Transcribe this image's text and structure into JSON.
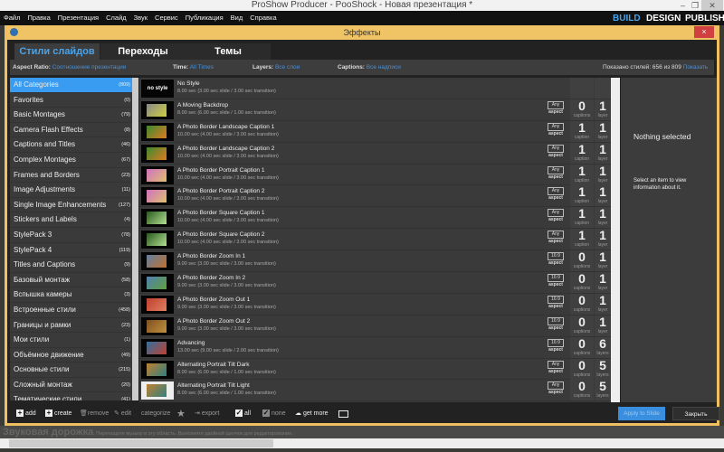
{
  "window": {
    "title": "ProShow Producer - PooShock - Новая презентация *",
    "minimize": "–",
    "maximize": "❐",
    "close": "✕"
  },
  "menu": [
    "Файл",
    "Правка",
    "Презентация",
    "Слайд",
    "Звук",
    "Сервис",
    "Публикация",
    "Вид",
    "Справка"
  ],
  "modes": {
    "build": "BUILD",
    "design": "DESIGN",
    "publish": "PUBLISH",
    "active": "BUILD"
  },
  "dialog": {
    "title": "Эффекты",
    "close": "×"
  },
  "tabs": [
    {
      "label": "Стили слайдов",
      "active": true
    },
    {
      "label": "Переходы"
    },
    {
      "label": "Темы"
    }
  ],
  "filters": {
    "aspect_label": "Aspect Ratio:",
    "aspect_value": "Соотношение презентации",
    "time_label": "Time:",
    "time_value": "All Times",
    "layers_label": "Layers:",
    "layers_value": "Все слои",
    "captions_label": "Captions:",
    "captions_value": "Все надписи",
    "shown": "Показано стилей: 656 из 809",
    "show_all": "Показать все"
  },
  "categories": [
    {
      "label": "All Categories",
      "count": "(809)",
      "selected": true
    },
    {
      "label": "Favorites",
      "count": "(0)"
    },
    {
      "label": "Basic Montages",
      "count": "(79)"
    },
    {
      "label": "Camera Flash Effects",
      "count": "(8)"
    },
    {
      "label": "Captions and Titles",
      "count": "(46)"
    },
    {
      "label": "Complex Montages",
      "count": "(67)"
    },
    {
      "label": "Frames and Borders",
      "count": "(23)"
    },
    {
      "label": "Image Adjustments",
      "count": "(11)"
    },
    {
      "label": "Single Image Enhancements",
      "count": "(127)"
    },
    {
      "label": "Stickers and Labels",
      "count": "(4)"
    },
    {
      "label": "StylePack 3",
      "count": "(78)"
    },
    {
      "label": "StylePack 4",
      "count": "(119)"
    },
    {
      "label": "Titles and Captions",
      "count": "(9)"
    },
    {
      "label": "Базовый монтаж",
      "count": "(58)"
    },
    {
      "label": "Вспышка камеры",
      "count": "(3)"
    },
    {
      "label": "Встроенные стили",
      "count": "(458)"
    },
    {
      "label": "Границы и рамки",
      "count": "(23)"
    },
    {
      "label": "Мои стили",
      "count": "(1)"
    },
    {
      "label": "Объёмное движение",
      "count": "(49)"
    },
    {
      "label": "Основные стили",
      "count": "(215)"
    },
    {
      "label": "Сложный монтаж",
      "count": "(20)"
    },
    {
      "label": "Тематические стили",
      "count": "(41)"
    }
  ],
  "styles": [
    {
      "name": "No Style",
      "desc": "8.00 sec (3.00 sec slide / 3.00 sec transition)",
      "thumb_text": "no style"
    },
    {
      "name": "A Moving Backdrop",
      "desc": "8.00 sec (6.00 sec slide / 1.00 sec transition)",
      "aspect": "Any",
      "captions": "0",
      "captions_label": "captions",
      "layers": "1",
      "layers_label": "layer",
      "thumb": [
        "#888",
        "#cfcf40"
      ]
    },
    {
      "name": "A Photo Border Landscape Caption 1",
      "desc": "10.00 sec (4.00 sec slide / 3.00 sec transition)",
      "aspect": "Any",
      "captions": "1",
      "captions_label": "caption",
      "layers": "1",
      "layers_label": "layer",
      "thumb": [
        "#3a8a30",
        "#e07a20"
      ]
    },
    {
      "name": "A Photo Border Landscape Caption 2",
      "desc": "10.00 sec (4.00 sec slide / 3.00 sec transition)",
      "aspect": "Any",
      "captions": "1",
      "captions_label": "caption",
      "layers": "1",
      "layers_label": "layer",
      "thumb": [
        "#3a8a30",
        "#e07a20"
      ]
    },
    {
      "name": "A Photo Border Portrait Caption 1",
      "desc": "10.00 sec (4.00 sec slide / 3.00 sec transition)",
      "aspect": "Any",
      "captions": "1",
      "captions_label": "caption",
      "layers": "1",
      "layers_label": "layer",
      "thumb": [
        "#d070c0",
        "#e0c070"
      ]
    },
    {
      "name": "A Photo Border Portrait Caption 2",
      "desc": "10.00 sec (4.00 sec slide / 3.00 sec transition)",
      "aspect": "Any",
      "captions": "1",
      "captions_label": "caption",
      "layers": "1",
      "layers_label": "layer",
      "thumb": [
        "#d070c0",
        "#e0c070"
      ]
    },
    {
      "name": "A Photo Border Square Caption 1",
      "desc": "10.00 sec (4.00 sec slide / 3.00 sec transition)",
      "aspect": "Any",
      "captions": "1",
      "captions_label": "caption",
      "layers": "1",
      "layers_label": "layer",
      "thumb": [
        "#2a5a20",
        "#b0e090"
      ]
    },
    {
      "name": "A Photo Border Square Caption 2",
      "desc": "10.00 sec (4.00 sec slide / 3.00 sec transition)",
      "aspect": "Any",
      "captions": "1",
      "captions_label": "caption",
      "layers": "1",
      "layers_label": "layer",
      "thumb": [
        "#2a5a20",
        "#b0e090"
      ]
    },
    {
      "name": "A Photo Border Zoom In 1",
      "desc": "9.00 sec (3.00 sec slide / 3.00 sec transition)",
      "aspect": "16:9",
      "captions": "0",
      "captions_label": "captions",
      "layers": "1",
      "layers_label": "layer",
      "thumb": [
        "#6080a0",
        "#c07030"
      ]
    },
    {
      "name": "A Photo Border Zoom In 2",
      "desc": "9.00 sec (3.00 sec slide / 3.00 sec transition)",
      "aspect": "16:9",
      "captions": "0",
      "captions_label": "captions",
      "layers": "1",
      "layers_label": "layer",
      "thumb": [
        "#5080b0",
        "#60a040"
      ]
    },
    {
      "name": "A Photo Border Zoom Out 1",
      "desc": "9.00 sec (3.00 sec slide / 3.00 sec transition)",
      "aspect": "16:9",
      "captions": "0",
      "captions_label": "captions",
      "layers": "1",
      "layers_label": "layer",
      "thumb": [
        "#c04030",
        "#e08060"
      ]
    },
    {
      "name": "A Photo Border Zoom Out 2",
      "desc": "9.00 sec (3.00 sec slide / 3.00 sec transition)",
      "aspect": "16:9",
      "captions": "0",
      "captions_label": "captions",
      "layers": "1",
      "layers_label": "layer",
      "thumb": [
        "#805020",
        "#c09040"
      ]
    },
    {
      "name": "Advancing",
      "desc": "13.00 sec (9.00 sec slide / 2.00 sec transition)",
      "aspect": "16:9",
      "captions": "0",
      "captions_label": "captions",
      "layers": "6",
      "layers_label": "layers",
      "thumb": [
        "#3070a0",
        "#c04030"
      ]
    },
    {
      "name": "Alternating Portrait Tilt Dark",
      "desc": "8.00 sec (6.00 sec slide / 1.00 sec transition)",
      "aspect": "Any",
      "captions": "0",
      "captions_label": "captions",
      "layers": "5",
      "layers_label": "layers",
      "thumb": [
        "#c08030",
        "#308080"
      ]
    },
    {
      "name": "Alternating Portrait Tilt Light",
      "desc": "8.00 sec (6.00 sec slide / 1.00 sec transition)",
      "aspect": "Any",
      "captions": "0",
      "captions_label": "captions",
      "layers": "5",
      "layers_label": "layers",
      "thumb": [
        "#c08030",
        "#308080"
      ],
      "light": true
    }
  ],
  "info": {
    "title": "Nothing selected",
    "hint": "Select an item to view information about it."
  },
  "toolbar": {
    "add": "add",
    "create": "create",
    "remove": "remove",
    "edit": "edit",
    "categorize": "categorize",
    "export": "export",
    "all": "all",
    "none": "none",
    "get_more": "get more",
    "apply": "Apply to Slide",
    "close": "Закрыть"
  },
  "audio": {
    "title": "Звуковая дорожка",
    "hint": "Перетащите музыку в эту область. Выполните двойной щелчок для редактирования."
  },
  "colors": {
    "accent": "#3a9cf0",
    "dialog_border": "#f0c060"
  }
}
